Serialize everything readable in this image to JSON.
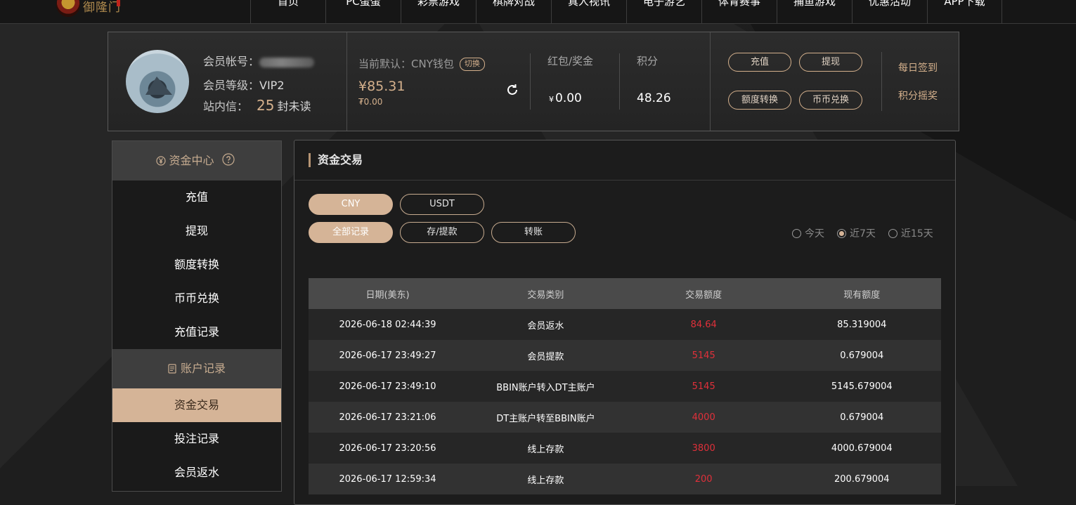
{
  "nav": {
    "logo_text": "御隆门",
    "items": [
      "首页",
      "PC蛋蛋",
      "彩票游戏",
      "棋牌对战",
      "真人视讯",
      "电子游艺",
      "体育赛事",
      "捕鱼游戏",
      "优惠活动",
      "APP下载"
    ]
  },
  "user": {
    "account_label": "会员帐号：",
    "level_label": "会员等级：",
    "level_value": "VIP2",
    "msg_label": "站内信：",
    "msg_count": "25",
    "msg_suffix": "封未读"
  },
  "wallet": {
    "label": "当前默认：CNY钱包",
    "switch_label": "切换",
    "amount": "¥85.31",
    "sub_amount": "₮0.00"
  },
  "stats": {
    "bonus_label": "红包/奖金",
    "bonus_currency": "¥",
    "bonus_value": "0.00",
    "points_label": "积分",
    "points_value": "48.26"
  },
  "actions": {
    "recharge": "充值",
    "withdraw": "提现",
    "transfer": "额度转换",
    "exchange": "币币兑换",
    "daily_checkin": "每日签到",
    "points_lottery": "积分摇奖"
  },
  "sidebar": {
    "section1": "资金中心",
    "items1": [
      "充值",
      "提现",
      "额度转换",
      "币币兑换",
      "充值记录"
    ],
    "section2": "账户记录",
    "items2": [
      "资金交易",
      "投注记录",
      "会员返水"
    ]
  },
  "main": {
    "title": "资金交易",
    "currency_tabs": [
      "CNY",
      "USDT"
    ],
    "type_tabs": [
      "全部记录",
      "存/提款",
      "转账"
    ],
    "ranges": [
      "今天",
      "近7天",
      "近15天"
    ],
    "selected_range": "近7天",
    "columns": [
      "日期(美东)",
      "交易类别",
      "交易额度",
      "现有额度"
    ],
    "rows": [
      [
        "2026-06-18 02:44:39",
        "会员返水",
        "84.64",
        "85.319004"
      ],
      [
        "2026-06-17 23:49:27",
        "会员提款",
        "5145",
        "0.679004"
      ],
      [
        "2026-06-17 23:49:10",
        "BBIN账户转入DT主账户",
        "5145",
        "5145.679004"
      ],
      [
        "2026-06-17 23:21:06",
        "DT主账户转至BBIN账户",
        "4000",
        "0.679004"
      ],
      [
        "2026-06-17 23:20:56",
        "线上存款",
        "3800",
        "4000.679004"
      ],
      [
        "2026-06-17 12:59:34",
        "线上存款",
        "200",
        "200.679004"
      ]
    ]
  },
  "colors": {
    "accent": "#d5b497",
    "amount_red": "#e0303a"
  }
}
